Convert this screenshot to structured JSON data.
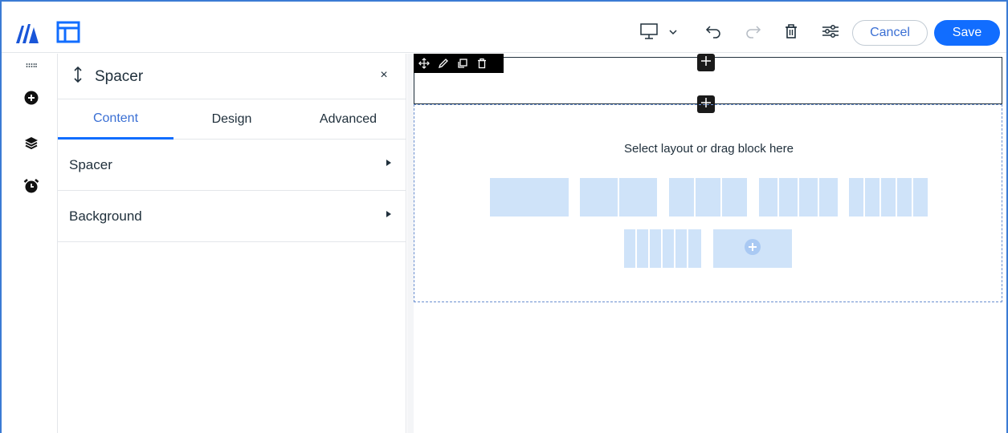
{
  "topbar": {
    "logo_icon": "wix-logo-icon",
    "layout_icon": "layout-panel-icon",
    "device_icon": "desktop-monitor-icon",
    "undo_icon": "undo-icon",
    "redo_icon": "redo-icon",
    "delete_icon": "trash-icon",
    "settings_icon": "sliders-icon",
    "cancel_label": "Cancel",
    "save_label": "Save",
    "accent_color": "#116dff"
  },
  "rail": {
    "items": [
      "drag-handle-icon",
      "add-circle-icon",
      "layers-icon",
      "alarm-clock-icon"
    ]
  },
  "panel": {
    "title": "Spacer",
    "close_label": "×",
    "tabs": [
      {
        "label": "Content",
        "active": true
      },
      {
        "label": "Design",
        "active": false
      },
      {
        "label": "Advanced",
        "active": false
      }
    ],
    "sections": [
      {
        "label": "Spacer"
      },
      {
        "label": "Background"
      }
    ]
  },
  "canvas": {
    "dropzone_text": "Select layout or drag block here",
    "layout_options": [
      1,
      2,
      3,
      4,
      5,
      6
    ]
  }
}
